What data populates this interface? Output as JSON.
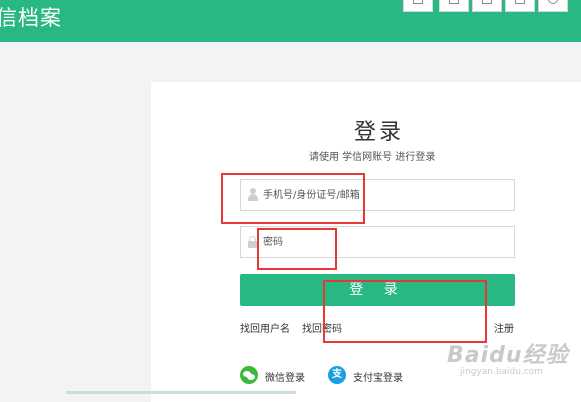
{
  "header": {
    "brand": "信档案",
    "tools": [
      "tool-1-icon",
      "expand-icon",
      "home-icon",
      "window-icon",
      "gear-icon"
    ]
  },
  "login": {
    "title": "登录",
    "subtitle": "请使用 学信网账号 进行登录",
    "account_placeholder": "手机号/身份证号/邮箱",
    "password_placeholder": "密码",
    "submit_label": "登 录",
    "forgot_username": "找回用户名",
    "forgot_password": "找回密码",
    "register": "注册",
    "wechat_login": "微信登录",
    "alipay_login": "支付宝登录",
    "alipay_glyph": "支"
  },
  "watermark": {
    "main": "Baidu经验",
    "sub": "jingyan.baidu.com"
  },
  "colors": {
    "accent": "#29b883",
    "annotation": "#e53935"
  }
}
